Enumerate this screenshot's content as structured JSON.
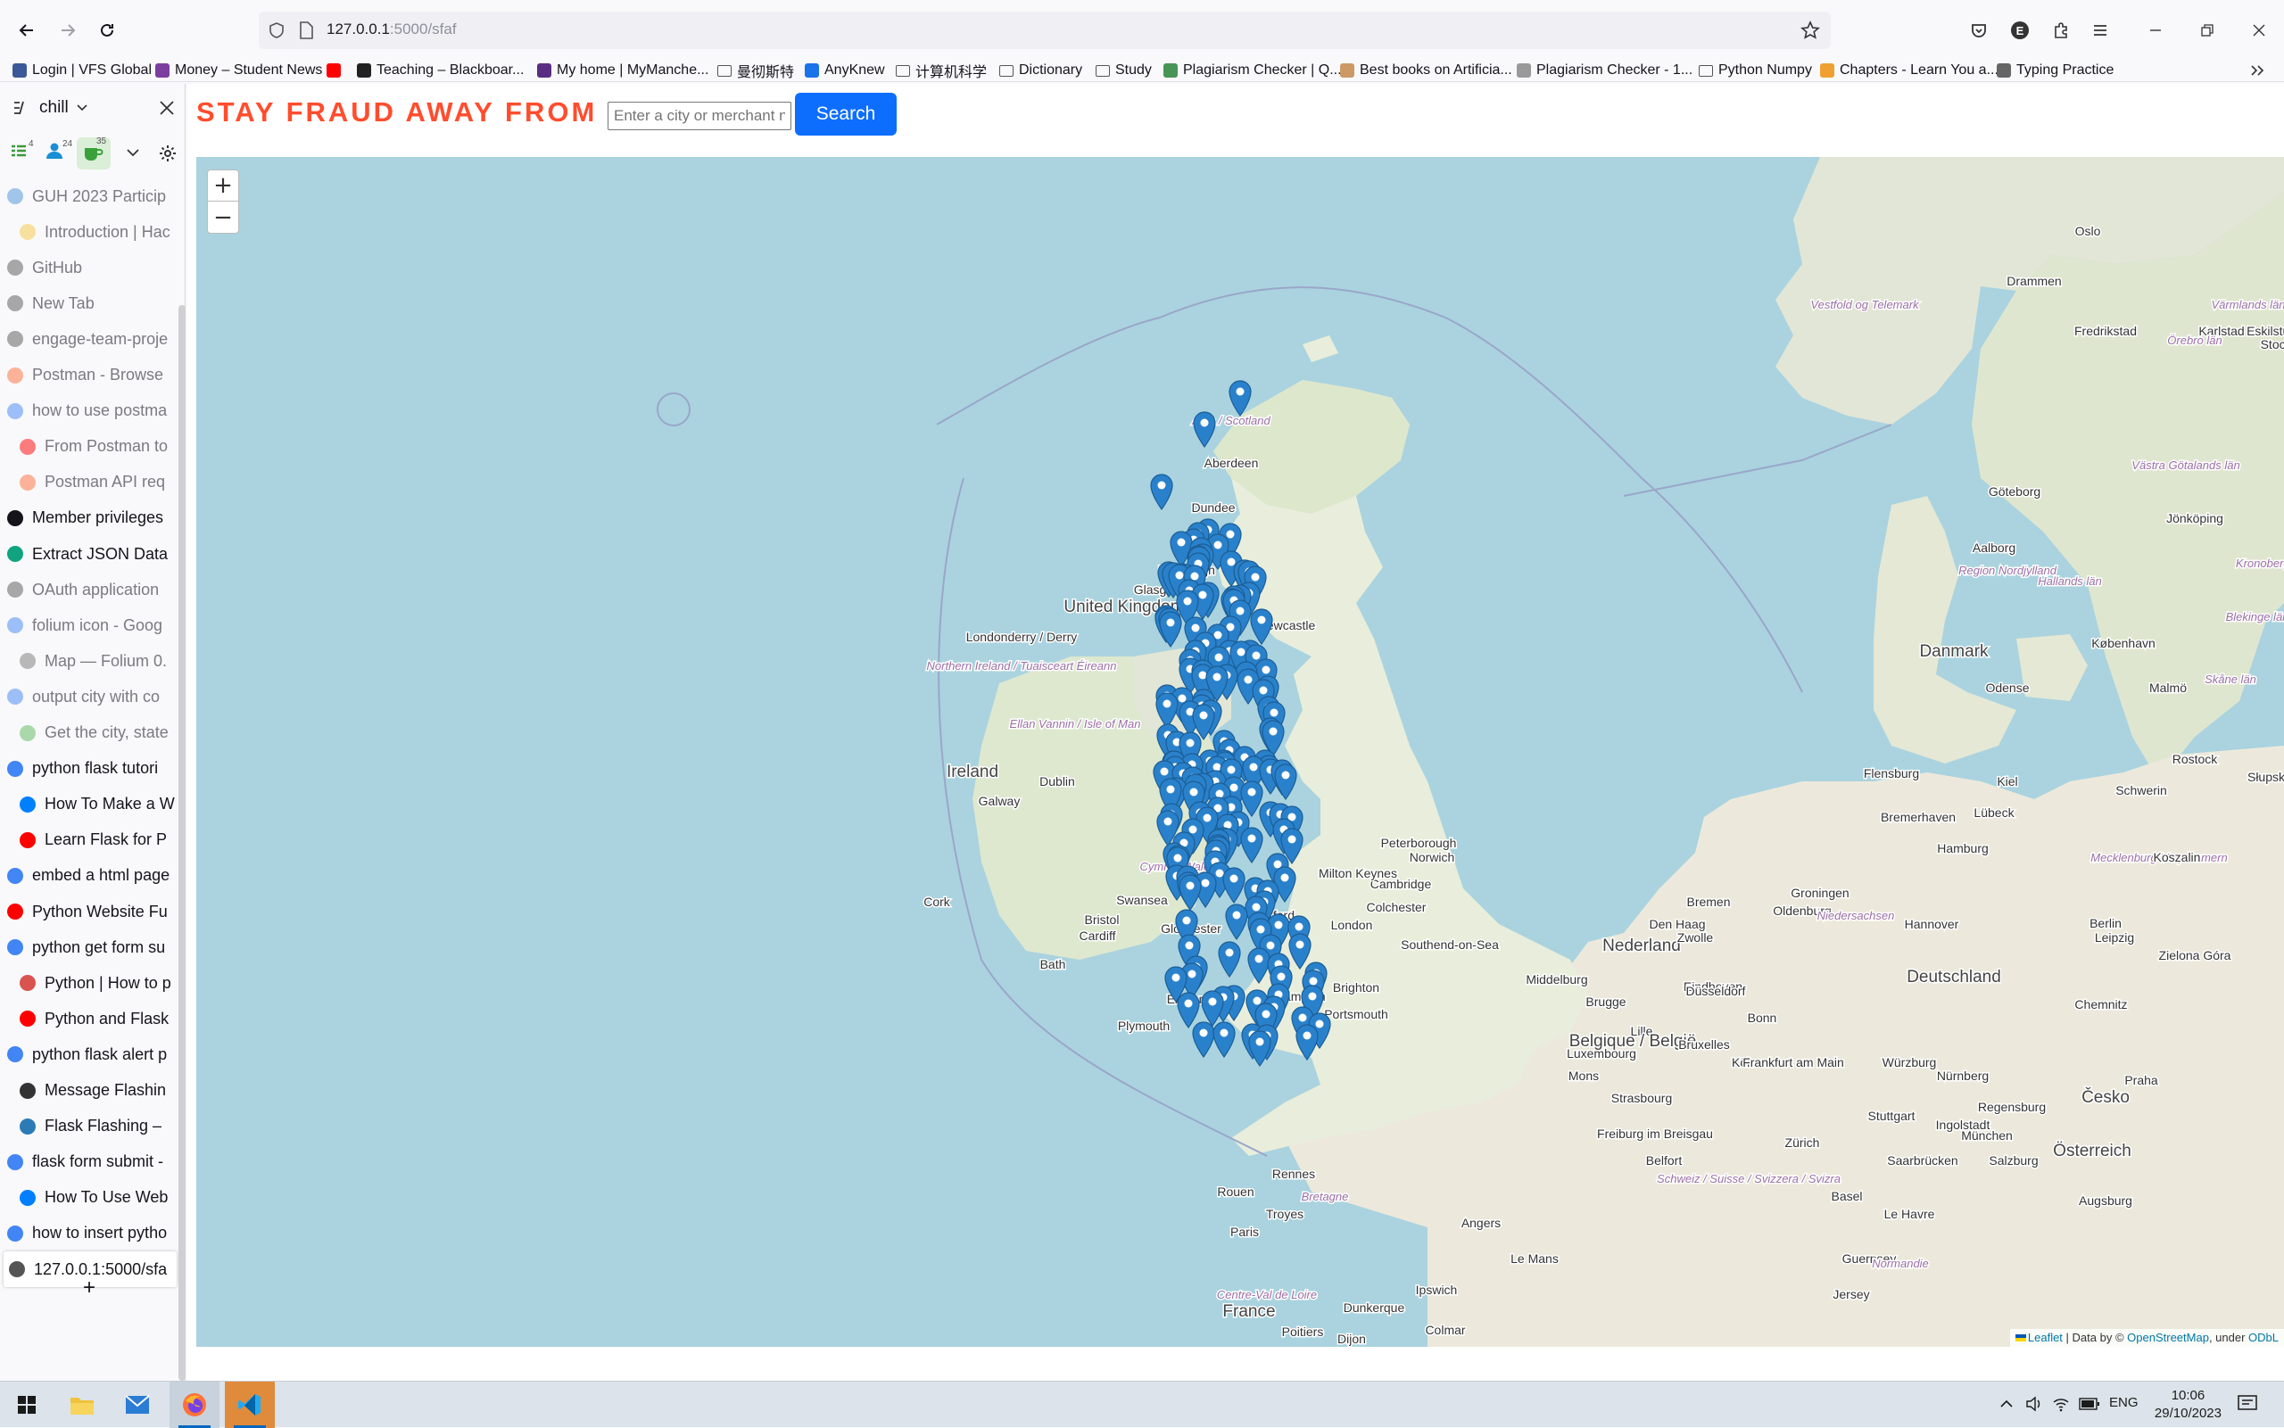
{
  "browser": {
    "url_host": "127.0.0.1",
    "url_rest": ":5000/sfaf",
    "bookmarks": [
      {
        "label": "Login | VFS Global",
        "icon": "vfs-icon",
        "color": "#3b5998"
      },
      {
        "label": "Money – Student News",
        "icon": "money-icon",
        "color": "#7b3fa0"
      },
      {
        "label": "",
        "icon": "youtube-icon",
        "color": "#ff0000"
      },
      {
        "label": "Teaching – Blackboar...",
        "icon": "blackboard-icon",
        "color": "#222222"
      },
      {
        "label": "My home | MyManche...",
        "icon": "mymanchester-icon",
        "color": "#5a2d82"
      },
      {
        "label": "曼彻斯特",
        "icon": "folder-icon",
        "color": "#555555"
      },
      {
        "label": "AnyKnew",
        "icon": "anyknew-icon",
        "color": "#1a73e8"
      },
      {
        "label": "计算机科学",
        "icon": "folder-icon",
        "color": "#555555"
      },
      {
        "label": "Dictionary",
        "icon": "folder-icon",
        "color": "#555555"
      },
      {
        "label": "Study",
        "icon": "folder-icon",
        "color": "#555555"
      },
      {
        "label": "Plagiarism Checker | Q...",
        "icon": "quillbot-icon",
        "color": "#499557"
      },
      {
        "label": "Best books on Artificia...",
        "icon": "books-icon",
        "color": "#c96"
      },
      {
        "label": "Plagiarism Checker - 1...",
        "icon": "sst-icon",
        "color": "#999999"
      },
      {
        "label": "Python Numpy",
        "icon": "folder-icon",
        "color": "#555555"
      },
      {
        "label": "Chapters - Learn You a...",
        "icon": "chapters-icon",
        "color": "#f0a030"
      },
      {
        "label": "Typing Practice",
        "icon": "typing-icon",
        "color": "#666666"
      }
    ]
  },
  "sidebar": {
    "title": "chill",
    "badges": {
      "tabs": "4",
      "users": "24",
      "cup": "35"
    },
    "tabs": [
      {
        "label": "GUH 2023 Particip",
        "dim": true,
        "color": "#4a90d9"
      },
      {
        "label": "Introduction | Hac",
        "dim": true,
        "color": "#f5c542"
      },
      {
        "label": "GitHub",
        "dim": true,
        "color": "#555555"
      },
      {
        "label": "New Tab",
        "dim": true,
        "color": "#555555"
      },
      {
        "label": "engage-team-proje",
        "dim": true,
        "color": "#555555"
      },
      {
        "label": "Postman - Browse",
        "dim": true,
        "color": "#ff6c37"
      },
      {
        "label": "how to use postma",
        "dim": true,
        "color": "#4285f4"
      },
      {
        "label": "From Postman to",
        "dim": true,
        "color": "#ff0000"
      },
      {
        "label": "Postman API req",
        "dim": true,
        "color": "#ff6c37"
      },
      {
        "label": "Member privileges",
        "dim": false,
        "color": "#15141a"
      },
      {
        "label": "Extract JSON Data",
        "dim": false,
        "color": "#10a37f"
      },
      {
        "label": "OAuth application",
        "dim": true,
        "color": "#555555"
      },
      {
        "label": "folium icon - Goog",
        "dim": true,
        "color": "#4285f4"
      },
      {
        "label": "Map — Folium 0.",
        "dim": true,
        "color": "#777777"
      },
      {
        "label": "output city with co",
        "dim": true,
        "color": "#4285f4"
      },
      {
        "label": "Get the city, state",
        "dim": true,
        "color": "#5cb85c"
      },
      {
        "label": "python flask tutori",
        "dim": false,
        "color": "#4285f4"
      },
      {
        "label": "How To Make a W",
        "dim": false,
        "color": "#0080ff"
      },
      {
        "label": "Learn Flask for P",
        "dim": false,
        "color": "#ff0000"
      },
      {
        "label": "embed a html page",
        "dim": false,
        "color": "#4285f4"
      },
      {
        "label": "Python Website Fu",
        "dim": false,
        "color": "#ff0000"
      },
      {
        "label": "python get form su",
        "dim": false,
        "color": "#4285f4"
      },
      {
        "label": "Python | How to p",
        "dim": false,
        "color": "#d9534f"
      },
      {
        "label": "Python and Flask",
        "dim": false,
        "color": "#ff0000"
      },
      {
        "label": "python flask alert p",
        "dim": false,
        "color": "#4285f4"
      },
      {
        "label": "Message Flashin",
        "dim": false,
        "color": "#333333"
      },
      {
        "label": "Flask Flashing –",
        "dim": false,
        "color": "#2c7bb6"
      },
      {
        "label": "flask form submit -",
        "dim": false,
        "color": "#4285f4"
      },
      {
        "label": "How To Use Web",
        "dim": false,
        "color": "#0080ff"
      },
      {
        "label": "how to insert pytho",
        "dim": false,
        "color": "#4285f4"
      },
      {
        "label": "127.0.0.1:5000/sfa",
        "dim": false,
        "color": "#555555",
        "active": true
      }
    ],
    "new_tab": "+"
  },
  "page": {
    "brand": "STAY FRAUD AWAY FROM",
    "search_placeholder": "Enter a city or merchant na",
    "search_button": "Search",
    "zoom_in": "+",
    "zoom_out": "−",
    "attribution": {
      "leaflet": "Leaflet",
      "sep": " | Data by © ",
      "osm": "OpenStreetMap",
      "under": ", under ",
      "odbl": "ODbL"
    }
  },
  "map": {
    "place_labels": [
      "Oslo",
      "Drammen",
      "Vestfold og Telemark",
      "Fredrikstad",
      "Karlstad",
      "Eskilstuna",
      "Stockh",
      "Värmlands län",
      "Örebro län",
      "Alba / Scotland",
      "Aberdeen",
      "Dundee",
      "Glasgow",
      "Edinburgh",
      "Newcastle",
      "United Kingdom",
      "Göteborg",
      "Västra Götalands län",
      "Jönköping",
      "Aalborg",
      "Region Nordjylland",
      "Danmark",
      "Hallands län",
      "Kronobergs län",
      "Blekinge län",
      "København",
      "Odense",
      "Malmö",
      "Skåne län",
      "Londonderry / Derry",
      "Northern Ireland / Tuaisceart Éireann",
      "Ellan Vannin / Isle of Man",
      "Ireland",
      "Dublin",
      "Galway",
      "Cork",
      "Cymru / Wales",
      "Swansea",
      "Cardiff",
      "Bath",
      "Bristol",
      "Gloucester",
      "Oxford",
      "Cambridge",
      "Norwich",
      "Peterborough",
      "Colchester",
      "London",
      "Southend-on-Sea",
      "Milton Keynes",
      "Exeter",
      "Plymouth",
      "Southampton",
      "Portsmouth",
      "Brighton",
      "Flensburg",
      "Kiel",
      "Rostock",
      "Schwerin",
      "Hamburg",
      "Bremerhaven",
      "Lübeck",
      "Mecklenburg-Vorpommern",
      "Groningen",
      "Oldenburg",
      "Bremen",
      "Niedersachsen",
      "Hannover",
      "Berlin",
      "Zielona Góra",
      "Leipzig",
      "Deutschland",
      "Chemnitz",
      "Praha",
      "Česko",
      "Koszalin",
      "Słupsk",
      "Den Haag",
      "Nederland",
      "Zwolle",
      "Eindhoven",
      "Middelburg",
      "Brugge",
      "Lille",
      "Belgique / België",
      "Bruxelles",
      "Düsseldorf",
      "Bonn",
      "Köln",
      "Luxembourg",
      "Mons",
      "Frankfurt am Main",
      "Würzburg",
      "Nürnberg",
      "Regensburg",
      "Ingolstadt",
      "München",
      "Salzburg",
      "Österreich",
      "Augsburg",
      "Stuttgart",
      "Saarbrücken",
      "Strasbourg",
      "Freiburg im Breisgau",
      "Zürich",
      "Schweiz / Suisse / Svizzera / Svizra",
      "Belfort",
      "Basel",
      "Guernsey",
      "Jersey",
      "Le Havre",
      "Normandie",
      "Rouen",
      "Paris",
      "Troyes",
      "Rennes",
      "Bretagne",
      "Angers",
      "Le Mans",
      "Centre-Val de Loire",
      "France",
      "Poitiers",
      "Dunkerque",
      "Ipswich",
      "Colmar",
      "Dijon"
    ],
    "marker_count": 180
  },
  "taskbar": {
    "time": "10:06",
    "date": "29/10/2023",
    "lang": "ENG"
  }
}
